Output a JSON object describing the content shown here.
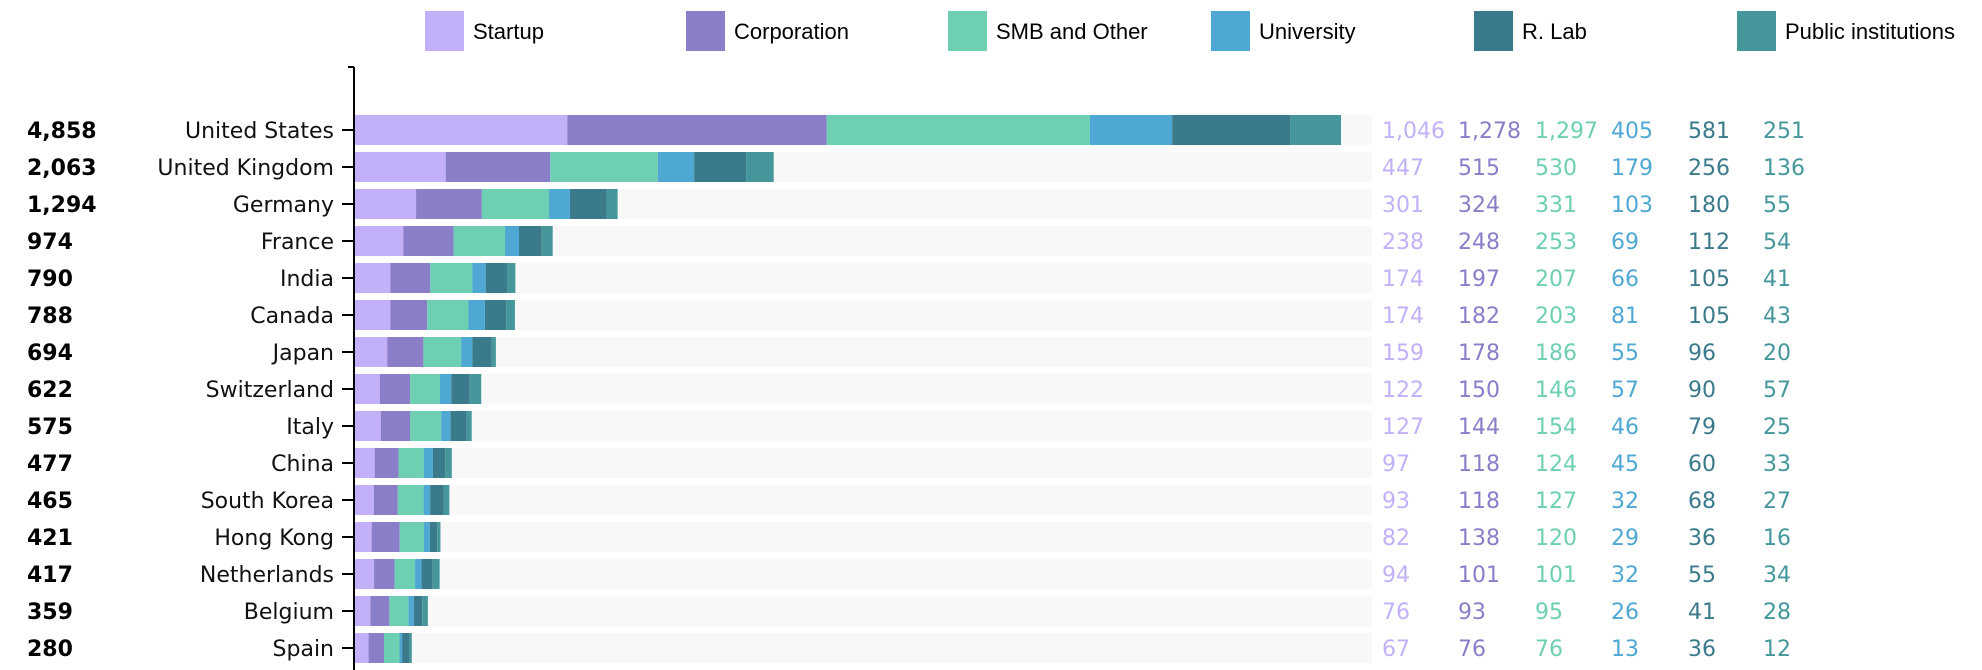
{
  "chart_data": {
    "type": "bar",
    "orientation": "horizontal",
    "stacked": true,
    "title": "",
    "xlabel": "",
    "ylabel": "",
    "legend_position": "top",
    "grid": false,
    "categories": [
      "United States",
      "United Kingdom",
      "Germany",
      "France",
      "India",
      "Canada",
      "Japan",
      "Switzerland",
      "Italy",
      "China",
      "South Korea",
      "Hong Kong",
      "Netherlands",
      "Belgium",
      "Spain"
    ],
    "totals": [
      "4,858",
      "2,063",
      "1,294",
      "974",
      "790",
      "788",
      "694",
      "622",
      "575",
      "477",
      "465",
      "421",
      "417",
      "359",
      "280"
    ],
    "total_values": [
      4858,
      2063,
      1294,
      974,
      790,
      788,
      694,
      622,
      575,
      477,
      465,
      421,
      417,
      359,
      280
    ],
    "series": [
      {
        "name": "Startup",
        "color": "#c2b0f8",
        "values": [
          1046,
          447,
          301,
          238,
          174,
          174,
          159,
          122,
          127,
          97,
          93,
          82,
          94,
          76,
          67
        ],
        "labels": [
          "1,046",
          "447",
          "301",
          "238",
          "174",
          "174",
          "159",
          "122",
          "127",
          "97",
          "93",
          "82",
          "94",
          "76",
          "67"
        ]
      },
      {
        "name": "Corporation",
        "color": "#8a7ec8",
        "values": [
          1278,
          515,
          324,
          248,
          197,
          182,
          178,
          150,
          144,
          118,
          118,
          138,
          101,
          93,
          76
        ],
        "labels": [
          "1,278",
          "515",
          "324",
          "248",
          "197",
          "182",
          "178",
          "150",
          "144",
          "118",
          "118",
          "138",
          "101",
          "93",
          "76"
        ]
      },
      {
        "name": "SMB and Other",
        "color": "#6ecfb2",
        "values": [
          1297,
          530,
          331,
          253,
          207,
          203,
          186,
          146,
          154,
          124,
          127,
          120,
          101,
          95,
          76
        ],
        "labels": [
          "1,297",
          "530",
          "331",
          "253",
          "207",
          "203",
          "186",
          "146",
          "154",
          "124",
          "127",
          "120",
          "101",
          "95",
          "76"
        ]
      },
      {
        "name": "University",
        "color": "#4fa8d4",
        "values": [
          405,
          179,
          103,
          69,
          66,
          81,
          55,
          57,
          46,
          45,
          32,
          29,
          32,
          26,
          13
        ],
        "labels": [
          "405",
          "179",
          "103",
          "69",
          "66",
          "81",
          "55",
          "57",
          "46",
          "45",
          "32",
          "29",
          "32",
          "26",
          "13"
        ]
      },
      {
        "name": "R. Lab",
        "color": "#3b7a8b",
        "values": [
          581,
          256,
          180,
          112,
          105,
          105,
          96,
          90,
          79,
          60,
          68,
          36,
          55,
          41,
          36
        ],
        "labels": [
          "581",
          "256",
          "180",
          "112",
          "105",
          "105",
          "96",
          "90",
          "79",
          "60",
          "68",
          "36",
          "55",
          "41",
          "36"
        ]
      },
      {
        "name": "Public institutions",
        "color": "#45979c",
        "values": [
          251,
          136,
          55,
          54,
          41,
          43,
          20,
          57,
          25,
          33,
          27,
          16,
          34,
          28,
          12
        ],
        "labels": [
          "251",
          "136",
          "55",
          "54",
          "41",
          "43",
          "20",
          "57",
          "25",
          "33",
          "27",
          "16",
          "34",
          "28",
          "12"
        ]
      }
    ],
    "background_track_color": "#f8f8f8"
  }
}
